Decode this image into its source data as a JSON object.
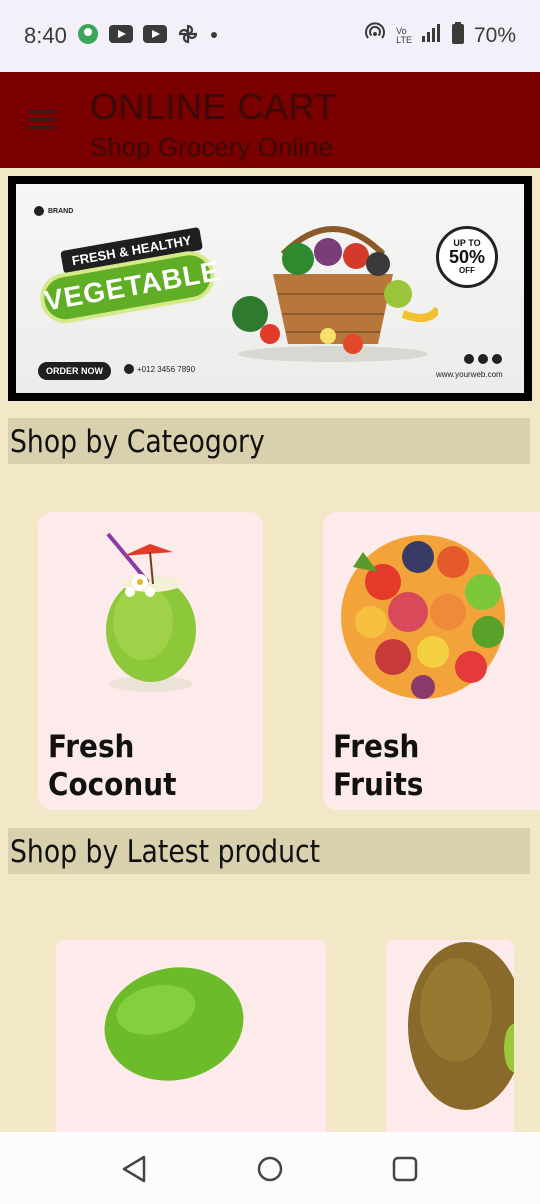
{
  "status_bar": {
    "time": "8:40",
    "battery": "70%",
    "net_small_1": "Vo",
    "net_small_2": "LTE",
    "icons": [
      "notification-badge-icon",
      "youtube-icon",
      "youtube-icon",
      "pinwheel-icon",
      "dot-icon",
      "hotspot-icon",
      "signal-icon",
      "battery-icon"
    ]
  },
  "app_bar": {
    "title": "ONLINE CART",
    "subtitle": "Shop Grocery Online",
    "background": "#7a0000"
  },
  "banner": {
    "brand": "BRAND",
    "tagline": "FRESH & HEALTHY",
    "headline": "VEGETABLE",
    "cta": "ORDER NOW",
    "phone": "+012 3456 7890",
    "offer_line1": "UP TO",
    "offer_value": "50%",
    "offer_line3": "OFF",
    "website": "www.yourweb.com"
  },
  "sections": {
    "category_title": "Shop by Cateogory",
    "latest_title": "Shop by Latest product"
  },
  "categories": [
    {
      "label": "Fresh Coconut",
      "icon": "coconut-drink-icon"
    },
    {
      "label": "Fresh Fruits",
      "icon": "fruits-pile-icon"
    }
  ],
  "products": [
    {
      "icon": "green-coconut-icon"
    },
    {
      "icon": "kiwi-icon"
    }
  ],
  "colors": {
    "page_bg": "#f2e8c8",
    "section_bg": "#d9d0ae",
    "card_bg": "#fdeaea",
    "accent_green": "#5fae25"
  }
}
